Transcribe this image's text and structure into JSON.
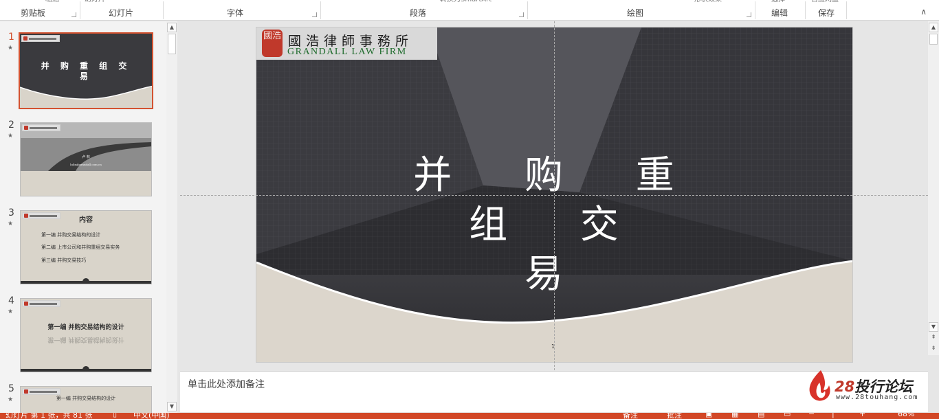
{
  "ribbon": {
    "cut_labels": [
      "粘贴",
      "幻灯片",
      "转换为SmartArt",
      "形状效果",
      "选择",
      "百度网盘"
    ],
    "groups": [
      {
        "label": "剪贴板"
      },
      {
        "label": "幻灯片"
      },
      {
        "label": "字体"
      },
      {
        "label": "段落"
      },
      {
        "label": "绘图"
      },
      {
        "label": "编辑"
      },
      {
        "label": "保存"
      }
    ],
    "collapse_icon": "∧"
  },
  "thumbnails": [
    {
      "num": "1",
      "star": "★",
      "title": "并 购 重 组 交 易",
      "selected": true
    },
    {
      "num": "2",
      "star": "★",
      "name": "卢 林",
      "email": "lulin@grandall.com.cn",
      "selected": false
    },
    {
      "num": "3",
      "star": "★",
      "heading": "内容",
      "items": [
        "第一编  并购交易结构的设计",
        "第二编  上市公司和并购重组交易实务",
        "第三编  并购交易技巧"
      ],
      "selected": false
    },
    {
      "num": "4",
      "star": "★",
      "heading": "第一编  并购交易结构的设计",
      "selected": false
    },
    {
      "num": "5",
      "star": "★",
      "heading": "第一编 并购交易结构的设计",
      "selected": false
    }
  ],
  "slide": {
    "logo_seal": "國浩",
    "logo_cn": "國浩律師事務所",
    "logo_en": "GRANDALL LAW FIRM",
    "title_line1": "并 购 重 组 交",
    "title_line2": "易",
    "page_number": "1"
  },
  "notes": {
    "placeholder": "单击此处添加备注"
  },
  "watermark": {
    "brand_num": "28",
    "brand_text": "投行论坛",
    "url": "www.28touhang.com"
  },
  "status": {
    "slide_info": "幻灯片 第 1 张，共 81 张",
    "language": "中文(中国)",
    "notes_btn": "备注",
    "comments_btn": "批注",
    "zoom": "68%"
  },
  "colors": {
    "accent": "#d24726",
    "selected_border": "#d35230",
    "slide_dark": "#3a3a3e",
    "slide_beige": "#dcd6cc",
    "logo_green": "#1e6b2c",
    "seal_red": "#c0392b"
  }
}
